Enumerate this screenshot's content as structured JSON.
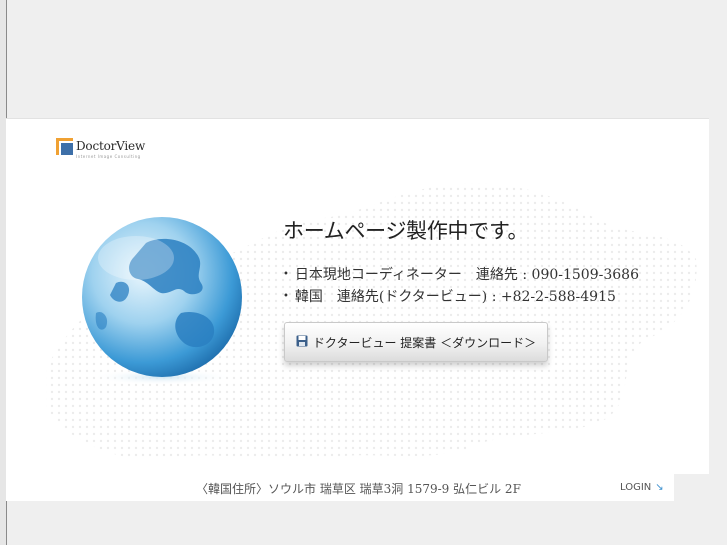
{
  "brand": {
    "name": "DoctorView",
    "tagline": "Internet Image Consulting"
  },
  "main": {
    "heading": "ホームページ製作中です。",
    "contacts": [
      {
        "bullet": "•",
        "text": "日本現地コーディネーター　連絡先 : 090-1509-3686"
      },
      {
        "bullet": "•",
        "text": "韓国　連絡先(ドクタービュー) : +82-2-588-4915"
      }
    ],
    "download_button": {
      "icon": "floppy-disk-icon",
      "label": "ドクタービュー 提案書 ＜ダウンロード＞"
    }
  },
  "footer": {
    "address": "〈韓国住所〉ソウル市 瑞草区 瑞草3洞 1579-9 弘仁ビル 2F",
    "login": {
      "label": "LOGIN",
      "icon": "arrow-down-right-icon",
      "arrow": "↘"
    }
  },
  "colors": {
    "logo_orange": "#f0a133",
    "logo_blue": "#3d6fa8",
    "globe_blue": "#2f8fd0",
    "login_arrow": "#3a8fcf"
  }
}
